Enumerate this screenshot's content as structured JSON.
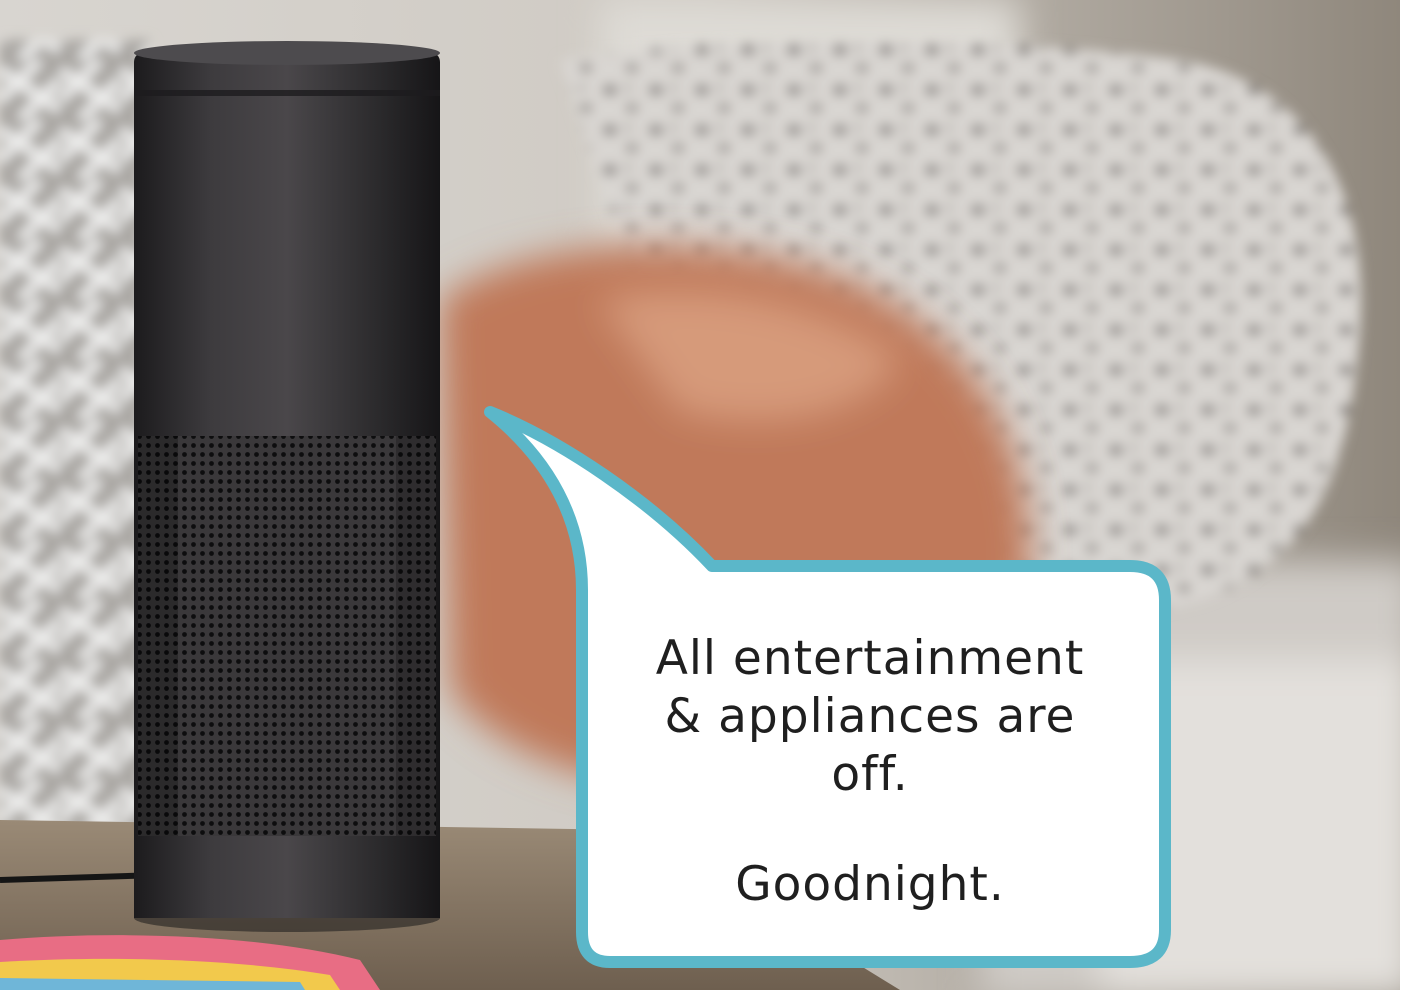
{
  "bubble": {
    "line1": "All entertainment",
    "line2": "& appliances are",
    "line3": "off.",
    "line4": "Goodnight."
  },
  "colors": {
    "bubble_border": "#5bb7c9",
    "bubble_fill": "#ffffff",
    "speaker_body": "#2d2c2d",
    "pillow_orange": "#c0795a"
  }
}
